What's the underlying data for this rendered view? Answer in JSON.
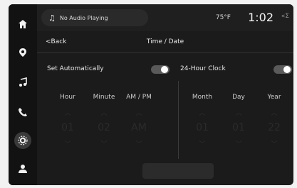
{
  "header": {
    "media_text": "No Audio Playing",
    "temperature": "75°F",
    "clock": "1:02",
    "signal_glyph": "«Σ"
  },
  "page": {
    "back_label": "<Back",
    "title": "Time / Date"
  },
  "settings": {
    "set_auto_label": "Set Automatically",
    "set_auto_on": true,
    "hour24_label": "24-Hour Clock",
    "hour24_on": true
  },
  "time": {
    "labels": [
      "Hour",
      "Minute",
      "AM / PM"
    ],
    "values": [
      "01",
      "02",
      "AM"
    ]
  },
  "date": {
    "labels": [
      "Month",
      "Day",
      "Year"
    ],
    "values": [
      "01",
      "01",
      "22"
    ]
  },
  "icons": [
    "home-icon",
    "location-icon",
    "music-icon",
    "phone-icon",
    "settings-icon",
    "profile-icon"
  ],
  "colors": {
    "background": "#1b1b1b",
    "disabled_text": "#2b2b2b",
    "toggle_on": "#ffffff"
  }
}
